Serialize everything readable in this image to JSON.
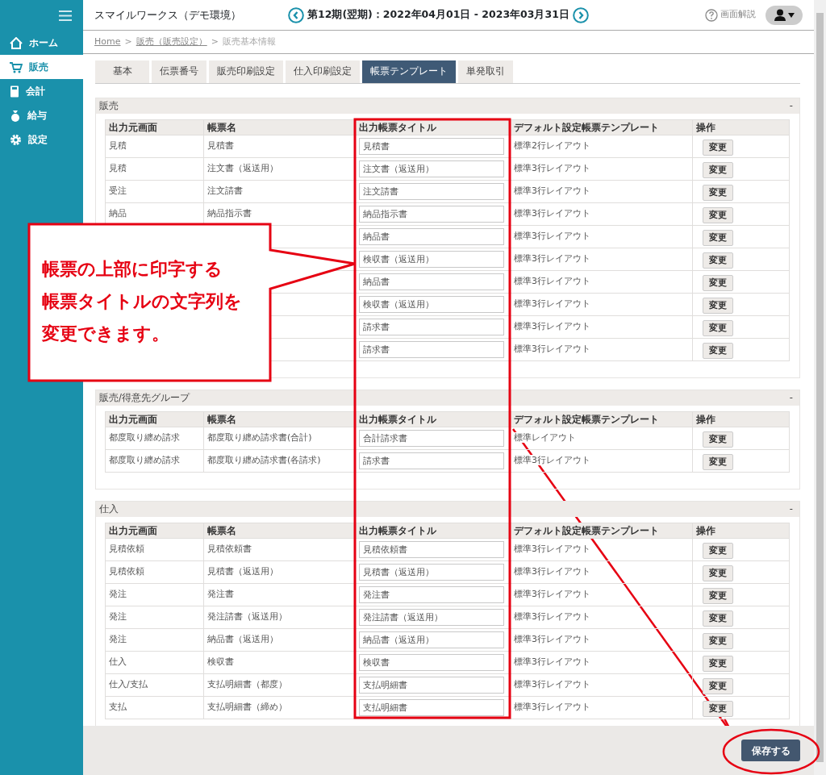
{
  "sidebar": {
    "items": [
      {
        "label": "ホーム",
        "kind": "home",
        "selected": false
      },
      {
        "label": "販売",
        "kind": "cart",
        "selected": true
      },
      {
        "label": "会計",
        "kind": "calculator",
        "selected": false
      },
      {
        "label": "給与",
        "kind": "moneybag",
        "selected": false
      },
      {
        "label": "設定",
        "kind": "gear",
        "selected": false
      }
    ]
  },
  "header": {
    "title": "スマイルワークス（デモ環境）",
    "period": "第12期(翌期)：2022年04月01日 - 2023年03月31日",
    "help": "画面解説"
  },
  "breadcrumb": {
    "separator": ">",
    "items": [
      {
        "text": "Home",
        "link": true
      },
      {
        "text": "販売（販売設定）",
        "link": true
      },
      {
        "text": "販売基本情報",
        "link": false
      }
    ]
  },
  "tabs": [
    {
      "label": "基本",
      "selected": false
    },
    {
      "label": "伝票番号",
      "selected": false
    },
    {
      "label": "販売印刷設定",
      "selected": false
    },
    {
      "label": "仕入印刷設定",
      "selected": false
    },
    {
      "label": "帳票テンプレート",
      "selected": true
    },
    {
      "label": "単発取引",
      "selected": false
    }
  ],
  "sections": [
    {
      "title": "販売",
      "collapse": "-",
      "columns": [
        "出力元画面",
        "帳票名",
        "出力帳票タイトル",
        "デフォルト設定帳票テンプレート",
        "操作"
      ],
      "rows": [
        {
          "source": "見積",
          "form_name": "見積書",
          "title_value": "見積書",
          "template": "標準2行レイアウト",
          "action": "変更"
        },
        {
          "source": "見積",
          "form_name": "注文書（返送用）",
          "title_value": "注文書（返送用）",
          "template": "標準3行レイアウト",
          "action": "変更"
        },
        {
          "source": "受注",
          "form_name": "注文請書",
          "title_value": "注文請書",
          "template": "標準3行レイアウト",
          "action": "変更"
        },
        {
          "source": "納品",
          "form_name": "納品指示書",
          "title_value": "納品指示書",
          "template": "標準3行レイアウト",
          "action": "変更"
        },
        {
          "title_value": "納品書",
          "template": "標準3行レイアウト",
          "action": "変更"
        },
        {
          "title_value": "検収書（返送用）",
          "template": "標準3行レイアウト",
          "action": "変更"
        },
        {
          "title_value": "納品書",
          "template": "標準3行レイアウト",
          "action": "変更"
        },
        {
          "title_value": "検収書（返送用）",
          "template": "標準3行レイアウト",
          "action": "変更"
        },
        {
          "title_value": "請求書",
          "template": "標準3行レイアウト",
          "action": "変更"
        },
        {
          "title_value": "請求書",
          "template": "標準3行レイアウト",
          "action": "変更"
        }
      ]
    },
    {
      "title": "販売/得意先グループ",
      "collapse": "-",
      "columns": [
        "出力元画面",
        "帳票名",
        "出力帳票タイトル",
        "デフォルト設定帳票テンプレート",
        "操作"
      ],
      "rows": [
        {
          "source": "都度取り纏め請求",
          "form_name": "都度取り纏め請求書(合計)",
          "title_value": "合計請求書",
          "template": "標準レイアウト",
          "action": "変更"
        },
        {
          "source": "都度取り纏め請求",
          "form_name": "都度取り纏め請求書(各請求)",
          "title_value": "請求書",
          "template": "標準3行レイアウト",
          "action": "変更"
        }
      ]
    },
    {
      "title": "仕入",
      "collapse": "-",
      "columns": [
        "出力元画面",
        "帳票名",
        "出力帳票タイトル",
        "デフォルト設定帳票テンプレート",
        "操作"
      ],
      "rows": [
        {
          "source": "見積依頼",
          "form_name": "見積依頼書",
          "title_value": "見積依頼書",
          "template": "標準3行レイアウト",
          "action": "変更"
        },
        {
          "source": "見積依頼",
          "form_name": "見積書（返送用）",
          "title_value": "見積書（返送用）",
          "template": "標準3行レイアウト",
          "action": "変更"
        },
        {
          "source": "発注",
          "form_name": "発注書",
          "title_value": "発注書",
          "template": "標準3行レイアウト",
          "action": "変更"
        },
        {
          "source": "発注",
          "form_name": "発注請書（返送用）",
          "title_value": "発注請書（返送用）",
          "template": "標準3行レイアウト",
          "action": "変更"
        },
        {
          "source": "発注",
          "form_name": "納品書（返送用）",
          "title_value": "納品書（返送用）",
          "template": "標準3行レイアウト",
          "action": "変更"
        },
        {
          "source": "仕入",
          "form_name": "検収書",
          "title_value": "検収書",
          "template": "標準3行レイアウト",
          "action": "変更"
        },
        {
          "source": "仕入/支払",
          "form_name": "支払明細書（都度）",
          "title_value": "支払明細書",
          "template": "標準3行レイアウト",
          "action": "変更"
        },
        {
          "source": "支払",
          "form_name": "支払明細書（締め）",
          "title_value": "支払明細書",
          "template": "標準3行レイアウト",
          "action": "変更"
        }
      ]
    }
  ],
  "footer": {
    "save": "保存する"
  },
  "annotation": {
    "lines": [
      "帳票の上部に印字する",
      "帳票タイトルの文字列を",
      "変更できます。"
    ]
  }
}
